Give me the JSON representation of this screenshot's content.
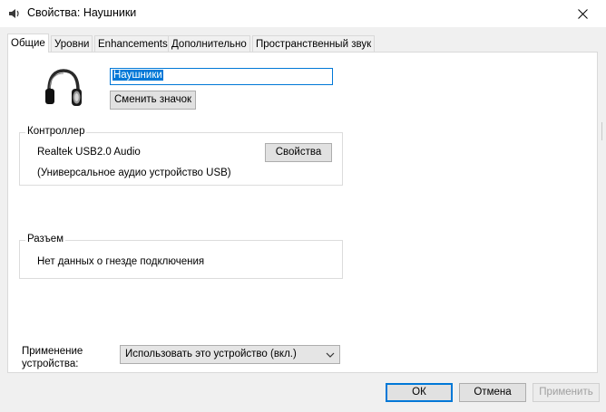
{
  "window": {
    "title": "Свойства: Наушники",
    "icon": "speaker-icon",
    "close_icon": "close-icon"
  },
  "tabs": [
    {
      "label": "Общие",
      "active": true
    },
    {
      "label": "Уровни",
      "active": false
    },
    {
      "label": "Enhancements",
      "active": false
    },
    {
      "label": "Дополнительно",
      "active": false
    },
    {
      "label": "Пространственный звук",
      "active": false
    }
  ],
  "device": {
    "icon": "headphones-icon",
    "name_value": "Наушники",
    "change_icon_label": "Сменить значок"
  },
  "controller": {
    "legend": "Контроллер",
    "name": "Realtek USB2.0 Audio",
    "description": "(Универсальное аудио устройство USB)",
    "properties_label": "Свойства"
  },
  "jack": {
    "legend": "Разъем",
    "text": "Нет данных о гнезде подключения"
  },
  "usage": {
    "label_line1": "Применение",
    "label_line2": "устройства:",
    "selected": "Использовать это устройство (вкл.)"
  },
  "buttons": {
    "ok": "ОК",
    "cancel": "Отмена",
    "apply": "Применить"
  },
  "colors": {
    "accent": "#0078d7",
    "window_bg": "#f0f0f0",
    "panel_bg": "#ffffff"
  }
}
